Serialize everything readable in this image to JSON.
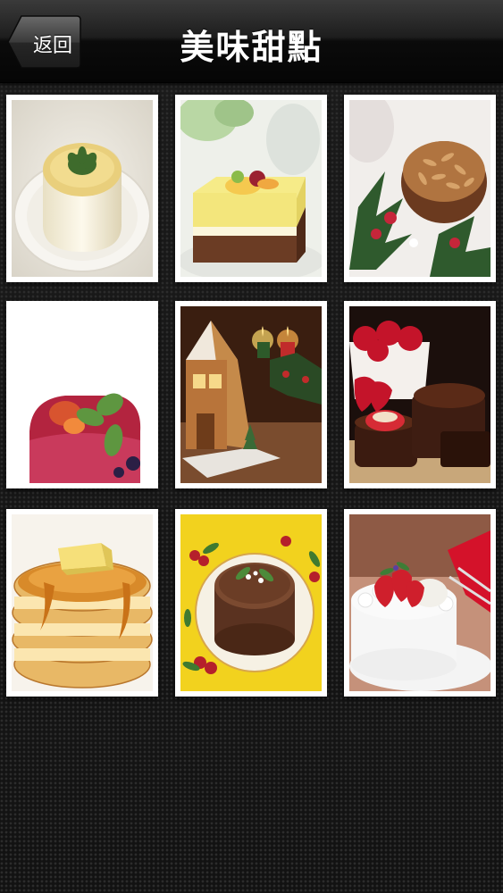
{
  "navbar": {
    "title": "美味甜點",
    "back_label": "返回"
  },
  "photos": [
    {
      "name": "panna-cotta"
    },
    {
      "name": "layered-mousse-cake"
    },
    {
      "name": "almond-chocolate-cake"
    },
    {
      "name": "berry-mousse"
    },
    {
      "name": "gingerbread-house"
    },
    {
      "name": "chocolate-brownies-strawberries"
    },
    {
      "name": "pancake-stack"
    },
    {
      "name": "chocolate-christmas-cake"
    },
    {
      "name": "strawberry-cream-cake"
    }
  ]
}
